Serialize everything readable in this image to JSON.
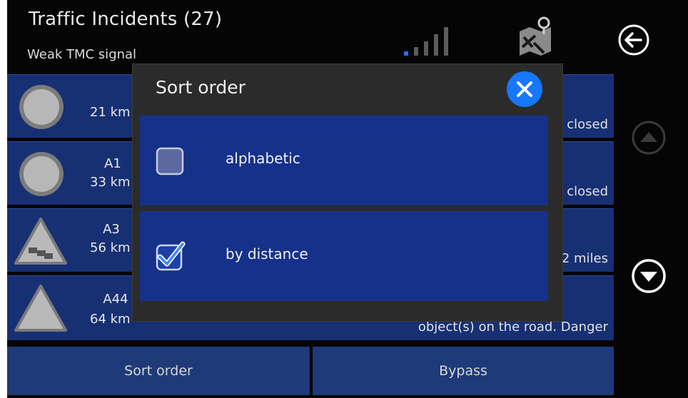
{
  "header": {
    "title": "Traffic Incidents (27)",
    "subtitle": "Weak TMC signal"
  },
  "signal": {
    "strength_bars": 1,
    "total_bars": 5,
    "active_color": "#2e6bff"
  },
  "incidents": [
    {
      "icon": "circle-restriction-icon",
      "road": "",
      "distance": "21 km",
      "info": "closed"
    },
    {
      "icon": "circle-restriction-icon",
      "road": "A1",
      "distance": "33 km",
      "info": "closed"
    },
    {
      "icon": "traffic-jam-warning-icon",
      "road": "A3",
      "distance": "56 km",
      "info": "2 miles"
    },
    {
      "icon": "danger-warning-icon",
      "road": "A44",
      "distance": "64 km",
      "info": "object(s) on the road. Danger"
    }
  ],
  "footer": {
    "sort_label": "Sort order",
    "bypass_label": "Bypass"
  },
  "dialog": {
    "title": "Sort order",
    "options": [
      {
        "label": "alphabetic",
        "checked": false
      },
      {
        "label": "by distance",
        "checked": true
      }
    ]
  },
  "colors": {
    "background": "#050505",
    "row": "#173073",
    "option": "#163189",
    "accent": "#1677ff"
  }
}
